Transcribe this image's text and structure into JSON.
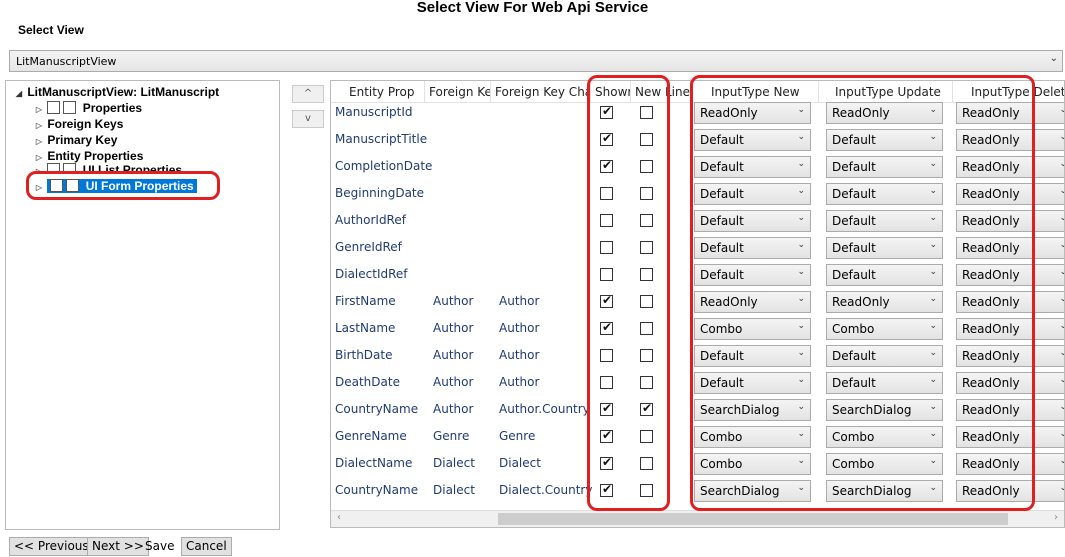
{
  "title": "Select View For Web Api Service",
  "select_view_label": "Select View",
  "view_combo_value": "LitManuscriptView",
  "tree": {
    "root": "LitManuscriptView: LitManuscript",
    "properties": "Properties",
    "foreign_keys": "Foreign Keys",
    "primary_key": "Primary Key",
    "entity_properties": "Entity Properties",
    "ui_list_properties": "UI List Properties",
    "ui_form_properties": "UI Form Properties"
  },
  "move_up": "^",
  "move_down": "v",
  "columns": {
    "entity_prop": "Entity Prop",
    "foreign_key": "Foreign Key",
    "foreign_key_chain": "Foreign Key Chain",
    "shown": "Shown",
    "new_line": "New Line",
    "input_new": "InputType New",
    "input_update": "InputType Update",
    "input_delete": "InputType Delete"
  },
  "rows": [
    {
      "prop": "ManuscriptId",
      "fk": "",
      "chain": "",
      "shown": true,
      "newline": false,
      "new": "ReadOnly",
      "update": "ReadOnly",
      "delete": "ReadOnly"
    },
    {
      "prop": "ManuscriptTitle",
      "fk": "",
      "chain": "",
      "shown": true,
      "newline": false,
      "new": "Default",
      "update": "Default",
      "delete": "ReadOnly"
    },
    {
      "prop": "CompletionDate",
      "fk": "",
      "chain": "",
      "shown": true,
      "newline": false,
      "new": "Default",
      "update": "Default",
      "delete": "ReadOnly"
    },
    {
      "prop": "BeginningDate",
      "fk": "",
      "chain": "",
      "shown": false,
      "newline": false,
      "new": "Default",
      "update": "Default",
      "delete": "ReadOnly"
    },
    {
      "prop": "AuthorIdRef",
      "fk": "",
      "chain": "",
      "shown": false,
      "newline": false,
      "new": "Default",
      "update": "Default",
      "delete": "ReadOnly"
    },
    {
      "prop": "GenreIdRef",
      "fk": "",
      "chain": "",
      "shown": false,
      "newline": false,
      "new": "Default",
      "update": "Default",
      "delete": "ReadOnly"
    },
    {
      "prop": "DialectIdRef",
      "fk": "",
      "chain": "",
      "shown": false,
      "newline": false,
      "new": "Default",
      "update": "Default",
      "delete": "ReadOnly"
    },
    {
      "prop": "FirstName",
      "fk": "Author",
      "chain": "Author",
      "shown": true,
      "newline": false,
      "new": "ReadOnly",
      "update": "ReadOnly",
      "delete": "ReadOnly"
    },
    {
      "prop": "LastName",
      "fk": "Author",
      "chain": "Author",
      "shown": true,
      "newline": false,
      "new": "Combo",
      "update": "Combo",
      "delete": "ReadOnly"
    },
    {
      "prop": "BirthDate",
      "fk": "Author",
      "chain": "Author",
      "shown": false,
      "newline": false,
      "new": "Default",
      "update": "Default",
      "delete": "ReadOnly"
    },
    {
      "prop": "DeathDate",
      "fk": "Author",
      "chain": "Author",
      "shown": false,
      "newline": false,
      "new": "Default",
      "update": "Default",
      "delete": "ReadOnly"
    },
    {
      "prop": "CountryName",
      "fk": "Author",
      "chain": "Author.Country",
      "shown": true,
      "newline": true,
      "new": "SearchDialog",
      "update": "SearchDialog",
      "delete": "ReadOnly"
    },
    {
      "prop": "GenreName",
      "fk": "Genre",
      "chain": "Genre",
      "shown": true,
      "newline": false,
      "new": "Combo",
      "update": "Combo",
      "delete": "ReadOnly"
    },
    {
      "prop": "DialectName",
      "fk": "Dialect",
      "chain": "Dialect",
      "shown": true,
      "newline": false,
      "new": "Combo",
      "update": "Combo",
      "delete": "ReadOnly"
    },
    {
      "prop": "CountryName",
      "fk": "Dialect",
      "chain": "Dialect.Country",
      "shown": true,
      "newline": false,
      "new": "SearchDialog",
      "update": "SearchDialog",
      "delete": "ReadOnly"
    }
  ],
  "footer": {
    "previous": "<< Previous",
    "next": "Next >>",
    "save": "Save",
    "cancel": "Cancel"
  }
}
